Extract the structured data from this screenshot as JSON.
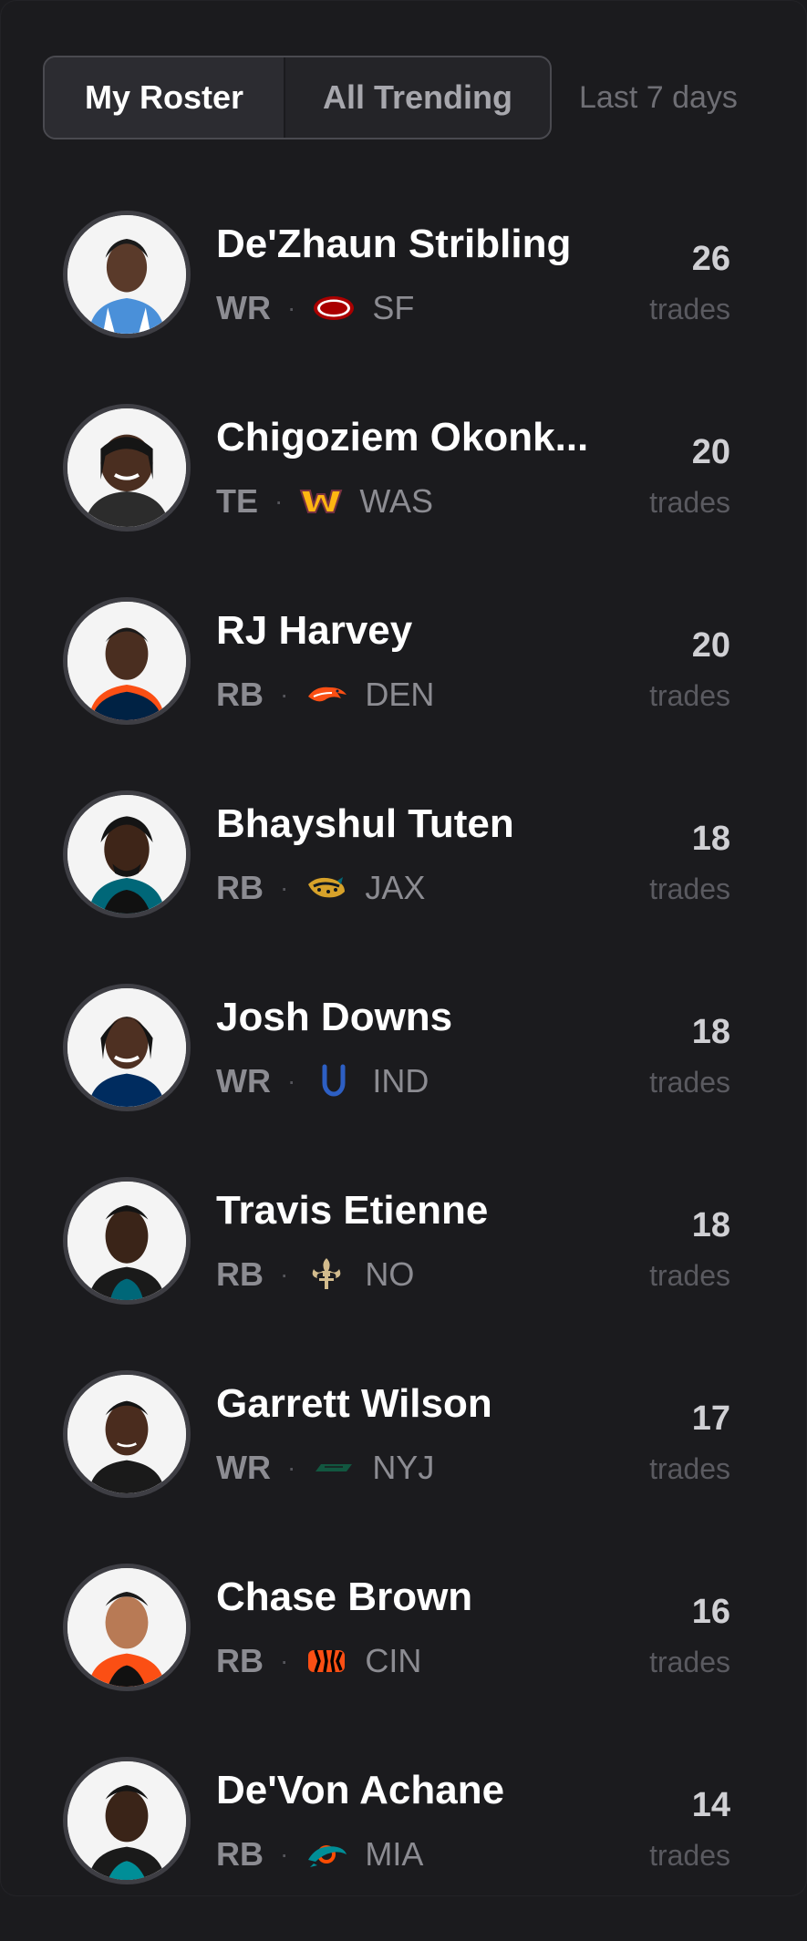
{
  "header": {
    "tabs": [
      {
        "label": "My Roster",
        "active": true
      },
      {
        "label": "All Trending",
        "active": false
      }
    ],
    "range_label": "Last 7 days"
  },
  "players": [
    {
      "name": "De'Zhaun Stribling",
      "position": "WR",
      "team": "SF",
      "team_logo": "49ers-logo-icon",
      "trades": "26",
      "trades_label": "trades"
    },
    {
      "name": "Chigoziem Okonk...",
      "position": "TE",
      "team": "WAS",
      "team_logo": "commanders-logo-icon",
      "trades": "20",
      "trades_label": "trades"
    },
    {
      "name": "RJ Harvey",
      "position": "RB",
      "team": "DEN",
      "team_logo": "broncos-logo-icon",
      "trades": "20",
      "trades_label": "trades"
    },
    {
      "name": "Bhayshul Tuten",
      "position": "RB",
      "team": "JAX",
      "team_logo": "jaguars-logo-icon",
      "trades": "18",
      "trades_label": "trades"
    },
    {
      "name": "Josh Downs",
      "position": "WR",
      "team": "IND",
      "team_logo": "colts-logo-icon",
      "trades": "18",
      "trades_label": "trades"
    },
    {
      "name": "Travis Etienne",
      "position": "RB",
      "team": "NO",
      "team_logo": "saints-logo-icon",
      "trades": "18",
      "trades_label": "trades"
    },
    {
      "name": "Garrett Wilson",
      "position": "WR",
      "team": "NYJ",
      "team_logo": "jets-logo-icon",
      "trades": "17",
      "trades_label": "trades"
    },
    {
      "name": "Chase Brown",
      "position": "RB",
      "team": "CIN",
      "team_logo": "bengals-logo-icon",
      "trades": "16",
      "trades_label": "trades"
    },
    {
      "name": "De'Von Achane",
      "position": "RB",
      "team": "MIA",
      "team_logo": "dolphins-logo-icon",
      "trades": "14",
      "trades_label": "trades"
    }
  ],
  "colors": {
    "background": "#1b1b1e",
    "text_primary": "#ffffff",
    "text_muted": "#8c8c92"
  }
}
